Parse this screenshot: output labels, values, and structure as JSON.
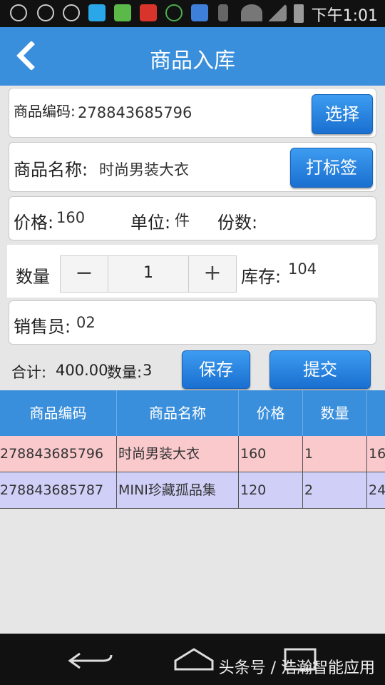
{
  "status_bar": {
    "time": "下午1:01"
  },
  "header": {
    "title": "商品入库"
  },
  "form": {
    "code_label": "商品编码:",
    "code_value": "278843685796",
    "select_button": "选择",
    "name_label": "商品名称:",
    "name_value": "时尚男装大衣",
    "label_button": "打标签",
    "price_label": "价格:",
    "price_value": "160",
    "unit_label": "单位:",
    "unit_value": "件",
    "copies_label": "份数:",
    "quantity_label": "数量",
    "quantity_minus": "−",
    "quantity_value": "1",
    "quantity_plus": "+",
    "stock_label": "库存:",
    "stock_value": "104",
    "seller_label": "销售员:",
    "seller_value": "02",
    "total_label": "合计:",
    "total_value": "400.00",
    "count_label": "数量:",
    "count_value": "3",
    "save_button": "保存",
    "submit_button": "提交"
  },
  "table": {
    "headers": [
      "商品编码",
      "商品名称",
      "价格",
      "数量"
    ],
    "rows": [
      {
        "code": "278843685796",
        "name": "时尚男装大衣",
        "price": "160",
        "qty": "1",
        "amount": "16"
      },
      {
        "code": "278843685787",
        "name": "MINI珍藏孤品集",
        "price": "120",
        "qty": "2",
        "amount": "24"
      }
    ]
  },
  "footer": {
    "caption": "头条号 / 浩瀚智能应用"
  },
  "colors": {
    "accent": "#3a8fdc",
    "row1_bg": "#f9c9cc",
    "row2_bg": "#cfcff7"
  }
}
